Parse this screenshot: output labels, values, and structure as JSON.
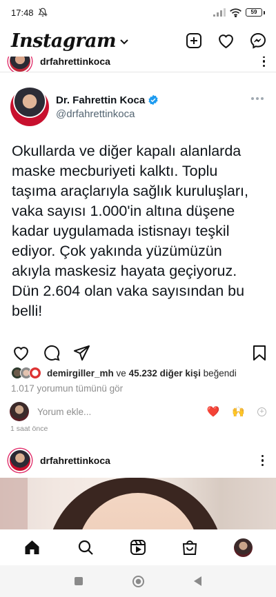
{
  "status_bar": {
    "time": "17:48",
    "battery": "59"
  },
  "app": {
    "logo": "Instagram"
  },
  "feed": {
    "partial_post": {
      "username": "drfahrettinkoca"
    },
    "tweet": {
      "name": "Dr. Fahrettin Koca",
      "handle": "@drfahrettinkoca",
      "text": "Okullarda ve diğer kapalı alanlarda maske mecburiyeti kalktı. Toplu taşıma araçlarıyla sağlık kuruluşları, vaka sayısı 1.000'in altına düşene kadar uygulamada istisnayı teşkil ediyor. Çok yakında yüzümüzün akıyla maskesiz hayata geçiyoruz. Dün 2.604 olan vaka sayısından bu belli!"
    },
    "likes": {
      "first_user": "demirgiller_mh",
      "and_word": "ve",
      "others": "45.232 diğer kişi",
      "liked_word": "beğendi"
    },
    "comments_link": "1.017 yorumun tümünü gör",
    "add_comment_placeholder": "Yorum ekle...",
    "quick_emojis": [
      "❤️",
      "🙌"
    ],
    "time_ago": "1 saat önce",
    "next_post": {
      "username": "drfahrettinkoca"
    }
  },
  "colors": {
    "verified": "#1d9bf0",
    "heart": "#ed4956",
    "story_ring": "#e1306c"
  }
}
